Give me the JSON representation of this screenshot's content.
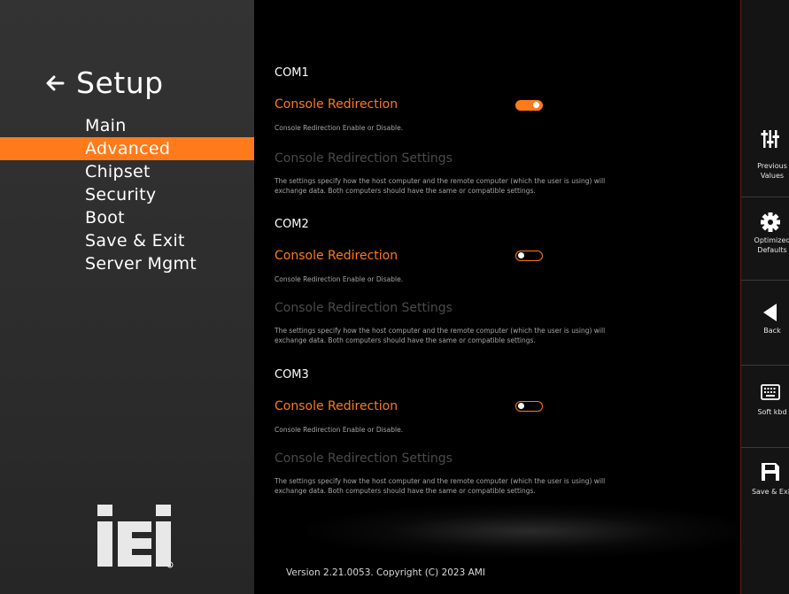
{
  "sidebar": {
    "title": "Setup",
    "nav_items": [
      {
        "label": "Main"
      },
      {
        "label": "Advanced"
      },
      {
        "label": "Chipset"
      },
      {
        "label": "Security"
      },
      {
        "label": "Boot"
      },
      {
        "label": "Save & Exit"
      },
      {
        "label": "Server Mgmt"
      }
    ],
    "active_index": 1,
    "logo_text": "iEi"
  },
  "main": {
    "sections": [
      {
        "heading": "COM1",
        "redirect_title": "Console Redirection",
        "redirect_desc": "Console Redirection Enable or Disable.",
        "redirect_state": "enabled",
        "settings_title": "Console Redirection Settings",
        "settings_desc_line1": "The settings specify how the host computer and the remote computer (which the user is using) will",
        "settings_desc_line2": "exchange data. Both computers should have the same or compatible settings."
      },
      {
        "heading": "COM2",
        "redirect_title": "Console Redirection",
        "redirect_desc": "Console Redirection Enable or Disable.",
        "redirect_state": "disabled",
        "settings_title": "Console Redirection Settings",
        "settings_desc_line1": "The settings specify how the host computer and the remote computer (which the user is using) will",
        "settings_desc_line2": "exchange data. Both computers should have the same or compatible settings."
      },
      {
        "heading": "COM3",
        "redirect_title": "Console Redirection",
        "redirect_desc": "Console Redirection Enable or Disable.",
        "redirect_state": "disabled",
        "settings_title": "Console Redirection Settings",
        "settings_desc_line1": "The settings specify how the host computer and the remote computer (which the user is using) will",
        "settings_desc_line2": "exchange data. Both computers should have the same or compatible settings."
      }
    ],
    "version": "Version 2.21.0053. Copyright (C) 2023 AMI"
  },
  "toolbar": {
    "buttons": [
      {
        "label": "Previous\nValues",
        "icon": "sliders-icon"
      },
      {
        "label": "Optimized\nDefaults",
        "icon": "gear-icon"
      },
      {
        "label": "Back",
        "icon": "back-triangle-icon"
      },
      {
        "label": "Soft kbd",
        "icon": "keyboard-icon"
      },
      {
        "label": "Save & Exit",
        "icon": "floppy-icon"
      }
    ]
  },
  "colors": {
    "accent": "#ff7a1a",
    "background": "#000000",
    "sidebar": "#2e2e2e",
    "dim_text": "#4b4b4b"
  }
}
